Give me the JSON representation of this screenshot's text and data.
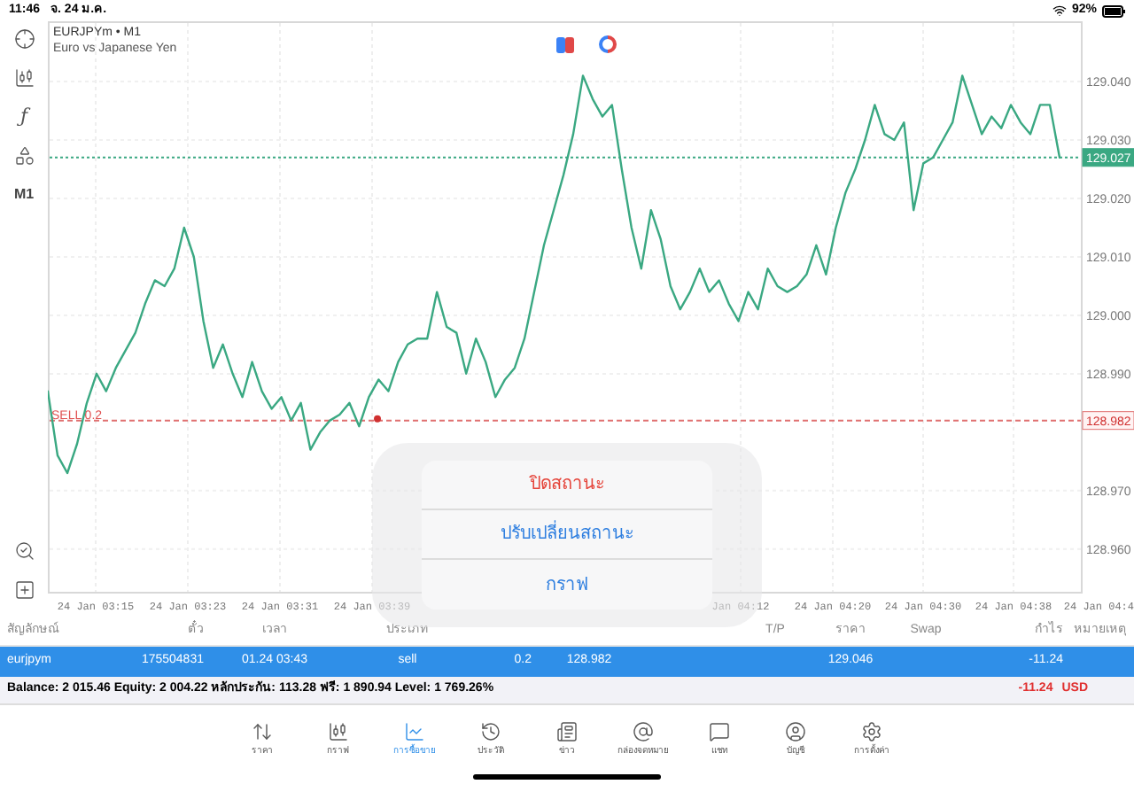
{
  "status_bar": {
    "time": "11:46",
    "date": "จ. 24 ม.ค.",
    "battery": "92%"
  },
  "toolbar": {
    "function_symbol": "ƒ",
    "timeframe": "M1"
  },
  "chart": {
    "symbol": "EURJPYm • M1",
    "description": "Euro vs Japanese Yen",
    "position_label": "SELL 0.2",
    "time_axis": [
      "24 Jan 03:15",
      "24 Jan 03:23",
      "24 Jan 03:31",
      "24 Jan 03:39",
      "Jan 04:12",
      "24 Jan 04:20",
      "24 Jan 04:30",
      "24 Jan 04:38",
      "24 Jan 04:4"
    ],
    "chart_data": {
      "type": "line",
      "grid": true,
      "series": [
        {
          "color": "#3aa882",
          "values": [
            128.987,
            128.976,
            128.973,
            128.978,
            128.985,
            128.99,
            128.987,
            128.991,
            128.994,
            128.997,
            129.002,
            129.006,
            129.005,
            129.008,
            129.015,
            129.01,
            128.999,
            128.991,
            128.995,
            128.99,
            128.986,
            128.992,
            128.987,
            128.984,
            128.986,
            128.982,
            128.985,
            128.977,
            128.98,
            128.982,
            128.983,
            128.985,
            128.981,
            128.986,
            128.989,
            128.987,
            128.992,
            128.995,
            128.996,
            128.996,
            129.004,
            128.998,
            128.997,
            128.99,
            128.996,
            128.992,
            128.986,
            128.989,
            128.991,
            128.996,
            129.004,
            129.012,
            129.018,
            129.024,
            129.031,
            129.041,
            129.037,
            129.034,
            129.036,
            129.025,
            129.015,
            129.008,
            129.018,
            129.013,
            129.005,
            129.001,
            129.004,
            129.008,
            129.004,
            129.006,
            129.002,
            128.999,
            129.004,
            129.001,
            129.008,
            129.005,
            129.004,
            129.005,
            129.007,
            129.012,
            129.007,
            129.015,
            129.021,
            129.025,
            129.03,
            129.036,
            129.031,
            129.03,
            129.033,
            129.018,
            129.026,
            129.027,
            129.03,
            129.033,
            129.041,
            129.036,
            129.031,
            129.034,
            129.032,
            129.036,
            129.033,
            129.031,
            129.036,
            129.036,
            129.027
          ]
        }
      ],
      "ylim": [
        128.9527,
        129.0503
      ],
      "yticks": [
        {
          "value": 129.04,
          "label": "129.040"
        },
        {
          "value": 129.03,
          "label": "129.030"
        },
        {
          "value": 129.02,
          "label": "129.020"
        },
        {
          "value": 129.01,
          "label": "129.010"
        },
        {
          "value": 129.0,
          "label": "129.000"
        },
        {
          "value": 128.99,
          "label": "128.990"
        },
        {
          "value": 128.97,
          "label": "128.970"
        },
        {
          "value": 128.96,
          "label": "128.960"
        }
      ],
      "ref_lines": [
        {
          "axis": "y",
          "value": 129.027,
          "label": "129.027",
          "color": "#3aa882"
        },
        {
          "axis": "y",
          "value": 128.982,
          "label": "128.982",
          "color": "#e07070"
        }
      ]
    }
  },
  "table": {
    "columns": [
      {
        "label": "สัญลักษณ์"
      },
      {
        "label": "ตั๋ว"
      },
      {
        "label": "เวลา"
      },
      {
        "label": "ประเภท"
      },
      {},
      {},
      {},
      {
        "label": "T/P"
      },
      {
        "label": "ราคา"
      },
      {
        "label": "Swap"
      },
      {
        "label": "กำไร"
      },
      {
        "label": "หมายเหตุ"
      }
    ],
    "rows": [
      {
        "selected": true,
        "cells": [
          "eurjpym",
          "175504831",
          "01.24 03:43",
          "sell",
          "0.2",
          "128.982",
          null,
          null,
          "129.046",
          null,
          "-11.24",
          null
        ]
      }
    ],
    "summary": "Balance: 2 015.46 Equity: 2 004.22 หลักประกัน: 113.28 ฟรี: 1 890.94 Level: 1 769.26%",
    "profit": "-11.24",
    "currency": "USD"
  },
  "action_sheet": [
    {
      "label": "ปิดสถานะ",
      "kind": "destructive"
    },
    {
      "label": "ปรับเปลี่ยนสถานะ",
      "kind": "default"
    },
    {
      "label": "กราฟ",
      "kind": "default"
    }
  ],
  "tab_bar": [
    {
      "label": "ราคา",
      "selected": false
    },
    {
      "label": "กราฟ",
      "selected": false
    },
    {
      "label": "การซื้อขาย",
      "selected": true
    },
    {
      "label": "ประวัติ",
      "selected": false
    },
    {
      "label": "ข่าว",
      "selected": false
    },
    {
      "label": "กล่องจดหมาย",
      "selected": false
    },
    {
      "label": "แชท",
      "selected": false
    },
    {
      "label": "บัญชี",
      "selected": false
    },
    {
      "label": "การตั้งค่า",
      "selected": false
    }
  ]
}
